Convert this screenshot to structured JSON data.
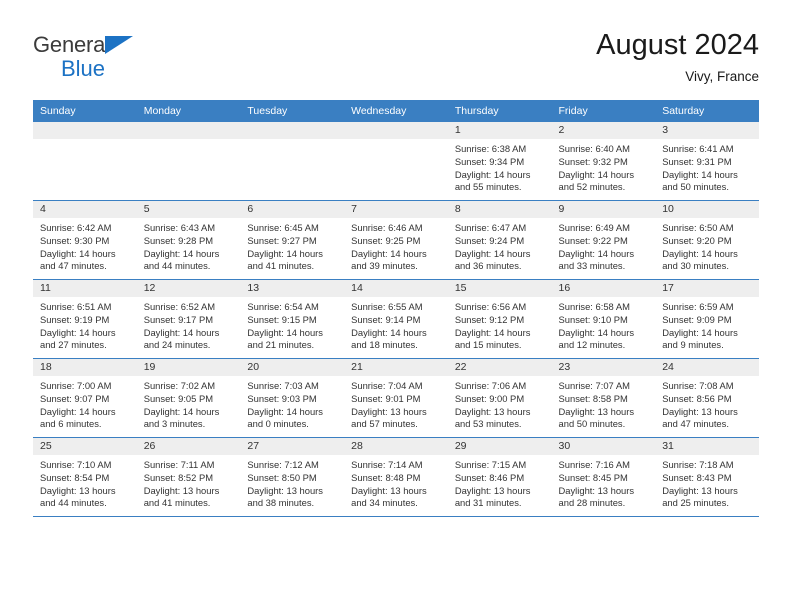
{
  "brand": {
    "name_top": "General",
    "name_bottom": "Blue",
    "accent_color": "#1c72c4",
    "triangle_icon": "triangle-icon"
  },
  "header": {
    "title": "August 2024",
    "location": "Vivy, France"
  },
  "calendar": {
    "header_bg": "#3a7fc2",
    "daynum_bg": "#eeeeee",
    "weekday_headers": [
      "Sunday",
      "Monday",
      "Tuesday",
      "Wednesday",
      "Thursday",
      "Friday",
      "Saturday"
    ],
    "labels": {
      "sunrise": "Sunrise:",
      "sunset": "Sunset:",
      "daylight": "Daylight:"
    },
    "weeks": [
      [
        {
          "day": "",
          "sunrise": "",
          "sunset": "",
          "daylight_hours": "",
          "daylight_minutes": ""
        },
        {
          "day": "",
          "sunrise": "",
          "sunset": "",
          "daylight_hours": "",
          "daylight_minutes": ""
        },
        {
          "day": "",
          "sunrise": "",
          "sunset": "",
          "daylight_hours": "",
          "daylight_minutes": ""
        },
        {
          "day": "",
          "sunrise": "",
          "sunset": "",
          "daylight_hours": "",
          "daylight_minutes": ""
        },
        {
          "day": "1",
          "sunrise": "Sunrise: 6:38 AM",
          "sunset": "Sunset: 9:34 PM",
          "daylight_hours": "Daylight: 14 hours",
          "daylight_minutes": "and 55 minutes."
        },
        {
          "day": "2",
          "sunrise": "Sunrise: 6:40 AM",
          "sunset": "Sunset: 9:32 PM",
          "daylight_hours": "Daylight: 14 hours",
          "daylight_minutes": "and 52 minutes."
        },
        {
          "day": "3",
          "sunrise": "Sunrise: 6:41 AM",
          "sunset": "Sunset: 9:31 PM",
          "daylight_hours": "Daylight: 14 hours",
          "daylight_minutes": "and 50 minutes."
        }
      ],
      [
        {
          "day": "4",
          "sunrise": "Sunrise: 6:42 AM",
          "sunset": "Sunset: 9:30 PM",
          "daylight_hours": "Daylight: 14 hours",
          "daylight_minutes": "and 47 minutes."
        },
        {
          "day": "5",
          "sunrise": "Sunrise: 6:43 AM",
          "sunset": "Sunset: 9:28 PM",
          "daylight_hours": "Daylight: 14 hours",
          "daylight_minutes": "and 44 minutes."
        },
        {
          "day": "6",
          "sunrise": "Sunrise: 6:45 AM",
          "sunset": "Sunset: 9:27 PM",
          "daylight_hours": "Daylight: 14 hours",
          "daylight_minutes": "and 41 minutes."
        },
        {
          "day": "7",
          "sunrise": "Sunrise: 6:46 AM",
          "sunset": "Sunset: 9:25 PM",
          "daylight_hours": "Daylight: 14 hours",
          "daylight_minutes": "and 39 minutes."
        },
        {
          "day": "8",
          "sunrise": "Sunrise: 6:47 AM",
          "sunset": "Sunset: 9:24 PM",
          "daylight_hours": "Daylight: 14 hours",
          "daylight_minutes": "and 36 minutes."
        },
        {
          "day": "9",
          "sunrise": "Sunrise: 6:49 AM",
          "sunset": "Sunset: 9:22 PM",
          "daylight_hours": "Daylight: 14 hours",
          "daylight_minutes": "and 33 minutes."
        },
        {
          "day": "10",
          "sunrise": "Sunrise: 6:50 AM",
          "sunset": "Sunset: 9:20 PM",
          "daylight_hours": "Daylight: 14 hours",
          "daylight_minutes": "and 30 minutes."
        }
      ],
      [
        {
          "day": "11",
          "sunrise": "Sunrise: 6:51 AM",
          "sunset": "Sunset: 9:19 PM",
          "daylight_hours": "Daylight: 14 hours",
          "daylight_minutes": "and 27 minutes."
        },
        {
          "day": "12",
          "sunrise": "Sunrise: 6:52 AM",
          "sunset": "Sunset: 9:17 PM",
          "daylight_hours": "Daylight: 14 hours",
          "daylight_minutes": "and 24 minutes."
        },
        {
          "day": "13",
          "sunrise": "Sunrise: 6:54 AM",
          "sunset": "Sunset: 9:15 PM",
          "daylight_hours": "Daylight: 14 hours",
          "daylight_minutes": "and 21 minutes."
        },
        {
          "day": "14",
          "sunrise": "Sunrise: 6:55 AM",
          "sunset": "Sunset: 9:14 PM",
          "daylight_hours": "Daylight: 14 hours",
          "daylight_minutes": "and 18 minutes."
        },
        {
          "day": "15",
          "sunrise": "Sunrise: 6:56 AM",
          "sunset": "Sunset: 9:12 PM",
          "daylight_hours": "Daylight: 14 hours",
          "daylight_minutes": "and 15 minutes."
        },
        {
          "day": "16",
          "sunrise": "Sunrise: 6:58 AM",
          "sunset": "Sunset: 9:10 PM",
          "daylight_hours": "Daylight: 14 hours",
          "daylight_minutes": "and 12 minutes."
        },
        {
          "day": "17",
          "sunrise": "Sunrise: 6:59 AM",
          "sunset": "Sunset: 9:09 PM",
          "daylight_hours": "Daylight: 14 hours",
          "daylight_minutes": "and 9 minutes."
        }
      ],
      [
        {
          "day": "18",
          "sunrise": "Sunrise: 7:00 AM",
          "sunset": "Sunset: 9:07 PM",
          "daylight_hours": "Daylight: 14 hours",
          "daylight_minutes": "and 6 minutes."
        },
        {
          "day": "19",
          "sunrise": "Sunrise: 7:02 AM",
          "sunset": "Sunset: 9:05 PM",
          "daylight_hours": "Daylight: 14 hours",
          "daylight_minutes": "and 3 minutes."
        },
        {
          "day": "20",
          "sunrise": "Sunrise: 7:03 AM",
          "sunset": "Sunset: 9:03 PM",
          "daylight_hours": "Daylight: 14 hours",
          "daylight_minutes": "and 0 minutes."
        },
        {
          "day": "21",
          "sunrise": "Sunrise: 7:04 AM",
          "sunset": "Sunset: 9:01 PM",
          "daylight_hours": "Daylight: 13 hours",
          "daylight_minutes": "and 57 minutes."
        },
        {
          "day": "22",
          "sunrise": "Sunrise: 7:06 AM",
          "sunset": "Sunset: 9:00 PM",
          "daylight_hours": "Daylight: 13 hours",
          "daylight_minutes": "and 53 minutes."
        },
        {
          "day": "23",
          "sunrise": "Sunrise: 7:07 AM",
          "sunset": "Sunset: 8:58 PM",
          "daylight_hours": "Daylight: 13 hours",
          "daylight_minutes": "and 50 minutes."
        },
        {
          "day": "24",
          "sunrise": "Sunrise: 7:08 AM",
          "sunset": "Sunset: 8:56 PM",
          "daylight_hours": "Daylight: 13 hours",
          "daylight_minutes": "and 47 minutes."
        }
      ],
      [
        {
          "day": "25",
          "sunrise": "Sunrise: 7:10 AM",
          "sunset": "Sunset: 8:54 PM",
          "daylight_hours": "Daylight: 13 hours",
          "daylight_minutes": "and 44 minutes."
        },
        {
          "day": "26",
          "sunrise": "Sunrise: 7:11 AM",
          "sunset": "Sunset: 8:52 PM",
          "daylight_hours": "Daylight: 13 hours",
          "daylight_minutes": "and 41 minutes."
        },
        {
          "day": "27",
          "sunrise": "Sunrise: 7:12 AM",
          "sunset": "Sunset: 8:50 PM",
          "daylight_hours": "Daylight: 13 hours",
          "daylight_minutes": "and 38 minutes."
        },
        {
          "day": "28",
          "sunrise": "Sunrise: 7:14 AM",
          "sunset": "Sunset: 8:48 PM",
          "daylight_hours": "Daylight: 13 hours",
          "daylight_minutes": "and 34 minutes."
        },
        {
          "day": "29",
          "sunrise": "Sunrise: 7:15 AM",
          "sunset": "Sunset: 8:46 PM",
          "daylight_hours": "Daylight: 13 hours",
          "daylight_minutes": "and 31 minutes."
        },
        {
          "day": "30",
          "sunrise": "Sunrise: 7:16 AM",
          "sunset": "Sunset: 8:45 PM",
          "daylight_hours": "Daylight: 13 hours",
          "daylight_minutes": "and 28 minutes."
        },
        {
          "day": "31",
          "sunrise": "Sunrise: 7:18 AM",
          "sunset": "Sunset: 8:43 PM",
          "daylight_hours": "Daylight: 13 hours",
          "daylight_minutes": "and 25 minutes."
        }
      ]
    ]
  }
}
